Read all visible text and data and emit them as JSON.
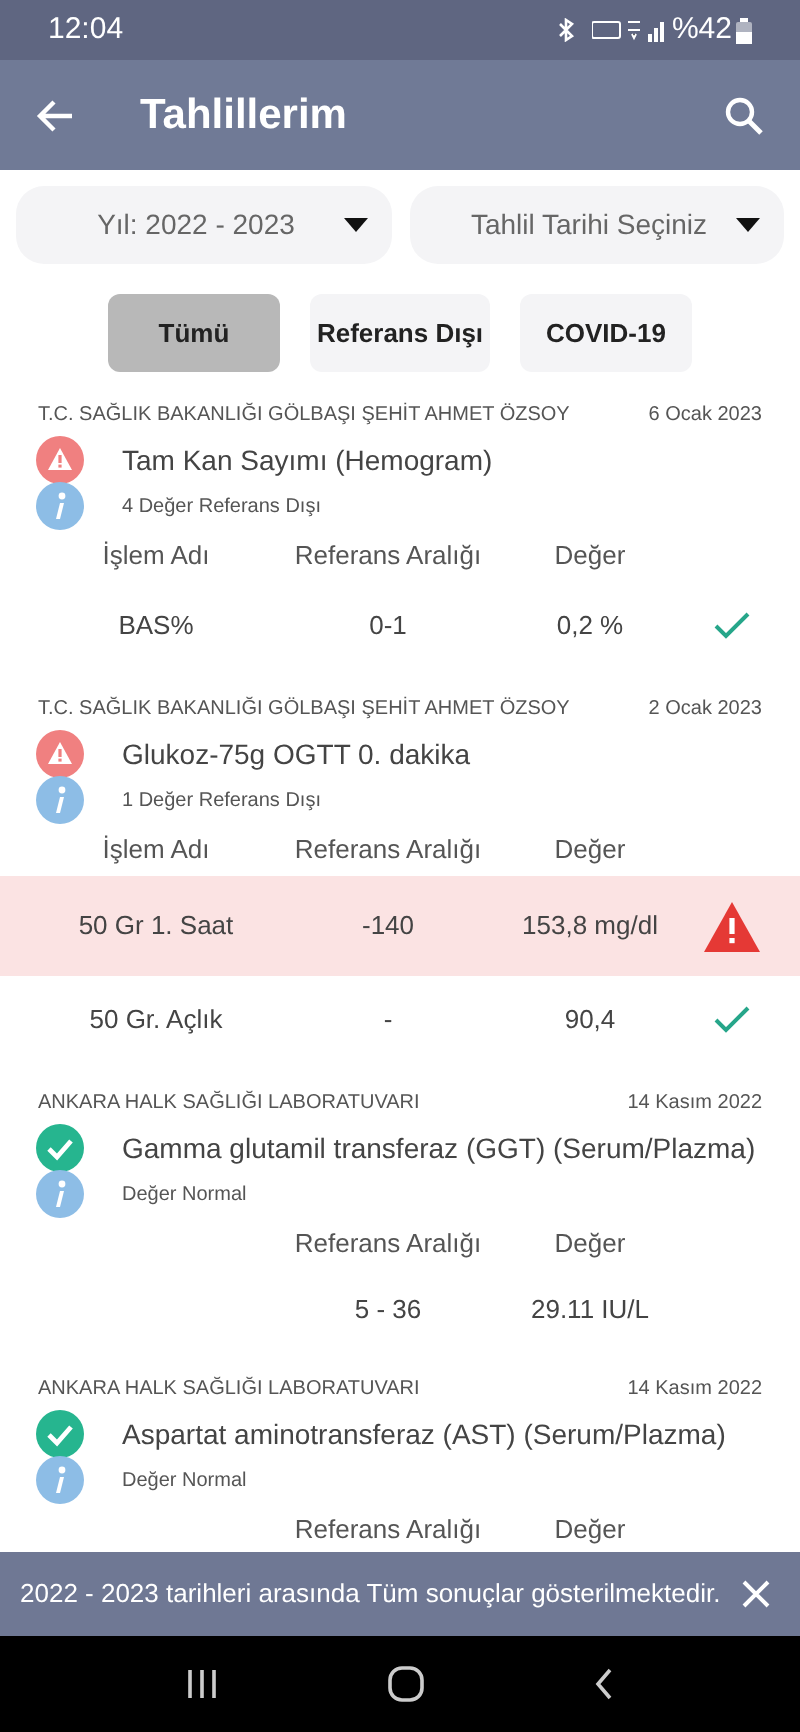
{
  "status_bar": {
    "time": "12:04",
    "battery": "%42"
  },
  "app_bar": {
    "title": "Tahlillerim"
  },
  "filters": {
    "year": "Yıl: 2022 - 2023",
    "date_placeholder": "Tahlil Tarihi Seçiniz"
  },
  "segments": [
    {
      "label": "Tümü",
      "selected": true
    },
    {
      "label": "Referans Dışı",
      "selected": false
    },
    {
      "label": "COVID-19",
      "selected": false
    }
  ],
  "results": [
    {
      "lab": "T.C. SAĞLIK BAKANLIĞI GÖLBAŞI ŞEHİT AHMET ÖZSOY",
      "date": "6 Ocak 2023",
      "kind": "warning",
      "title": "Tam Kan Sayımı (Hemogram)",
      "note": "4 Değer Referans Dışı",
      "columns": [
        "İşlem Adı",
        "Referans Aralığı",
        "Değer"
      ],
      "rows": [
        {
          "cells": [
            "BAS%",
            "0-1",
            "0,2 %"
          ],
          "kind": "ok"
        }
      ]
    },
    {
      "lab": "T.C. SAĞLIK BAKANLIĞI GÖLBAŞI ŞEHİT AHMET ÖZSOY",
      "date": "2 Ocak 2023",
      "kind": "warning",
      "title": "Glukoz-75g OGTT 0. dakika",
      "note": "1 Değer Referans Dışı",
      "columns": [
        "İşlem Adı",
        "Referans Aralığı",
        "Değer"
      ],
      "rows": [
        {
          "cells": [
            "50 Gr 1. Saat",
            "-140",
            "153,8 mg/dl"
          ],
          "kind": "out"
        },
        {
          "cells": [
            "50 Gr. Açlık",
            "-",
            "90,4"
          ],
          "kind": "ok"
        }
      ]
    },
    {
      "lab": "ANKARA HALK SAĞLIĞI LABORATUVARI",
      "date": "14 Kasım 2022",
      "kind": "normal",
      "title": "Gamma glutamil transferaz (GGT) (Serum/Plazma)",
      "note": "Değer Normal",
      "columns": [
        null,
        "Referans Aralığı",
        "Değer"
      ],
      "rows": [
        {
          "cells": [
            null,
            "5 - 36",
            "29.11 IU/L"
          ],
          "kind": "plain"
        }
      ]
    },
    {
      "lab": "ANKARA HALK SAĞLIĞI LABORATUVARI",
      "date": "14 Kasım 2022",
      "kind": "normal",
      "title": "Aspartat aminotransferaz (AST) (Serum/Plazma)",
      "note": "Değer Normal",
      "columns": [
        null,
        "Referans Aralığı",
        "Değer"
      ]
    }
  ],
  "snackbar": {
    "message": "2022 - 2023 tarihleri arasında Tüm sonuçlar gösterilmektedir."
  }
}
